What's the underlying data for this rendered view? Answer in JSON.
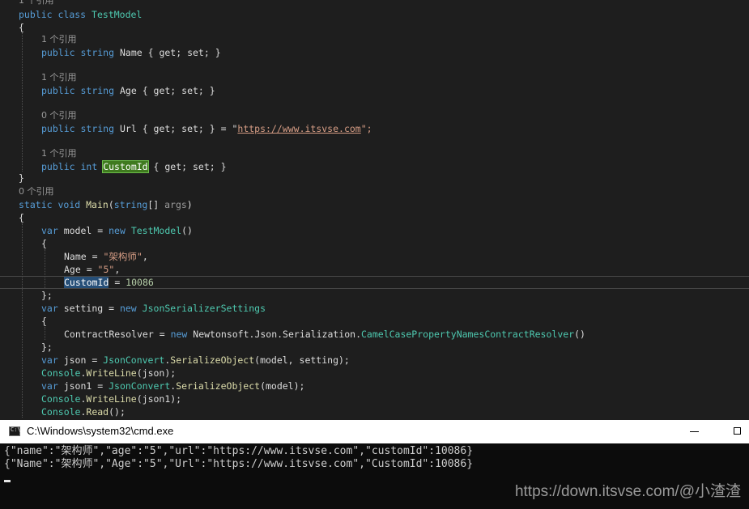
{
  "editor": {
    "codelens": {
      "ref1": "1 个引用",
      "ref0": "0 个引用"
    },
    "class_header": {
      "kw_public": "public",
      "kw_class": "class",
      "name": "TestModel"
    },
    "braces": {
      "open": "{",
      "close": "}",
      "close_semi": "};"
    },
    "props": {
      "kw_public": "public",
      "kw_string": "string",
      "kw_int": "int",
      "name_prop": "Name",
      "age_prop": "Age",
      "url_prop": "Url",
      "customid_prop": "CustomId",
      "accessors": "{ get; set; }",
      "url_assign_prefix": " = \"",
      "url_value": "https://www.itsvse.com",
      "url_assign_suffix": "\";"
    },
    "main_sig": {
      "kw_static": "static",
      "kw_void": "void",
      "name": "Main",
      "kw_string": "string",
      "param_decl": "[] ",
      "param": "args",
      "close": ")"
    },
    "body": {
      "kw_var": "var",
      "kw_new": "new",
      "model_lhs": " model = ",
      "model_type": "TestModel",
      "parens": "()",
      "init_name_lhs": "Name = ",
      "init_name_val": "\"架构师\"",
      "init_age_lhs": "Age = ",
      "init_age_val": "\"5\"",
      "comma": ",",
      "init_customid": "CustomId",
      "init_customid_eq": " = ",
      "init_customid_val": "10086",
      "setting_lhs": " setting = ",
      "settings_type": "JsonSerializerSettings",
      "resolver_lhs": "ContractResolver = ",
      "resolver_ns": "Newtonsoft.Json.Serialization.",
      "resolver_type": "CamelCasePropertyNamesContractResolver",
      "json_lhs": " json = ",
      "json1_lhs": " json1 = ",
      "jsonconvert": "JsonConvert",
      "dot": ".",
      "serialize": "SerializeObject",
      "args_model_setting": "(model, setting);",
      "args_model": "(model);",
      "console": "Console",
      "writeline": "WriteLine",
      "args_json": "(json);",
      "args_json1": "(json1);",
      "read": "Read",
      "read_args": "();"
    }
  },
  "cmd": {
    "title": "C:\\Windows\\system32\\cmd.exe",
    "output": [
      "{\"name\":\"架构师\",\"age\":\"5\",\"url\":\"https://www.itsvse.com\",\"customId\":10086}",
      "{\"Name\":\"架构师\",\"Age\":\"5\",\"Url\":\"https://www.itsvse.com\",\"CustomId\":10086}"
    ]
  },
  "watermark": "https://down.itsvse.com/@小渣渣"
}
